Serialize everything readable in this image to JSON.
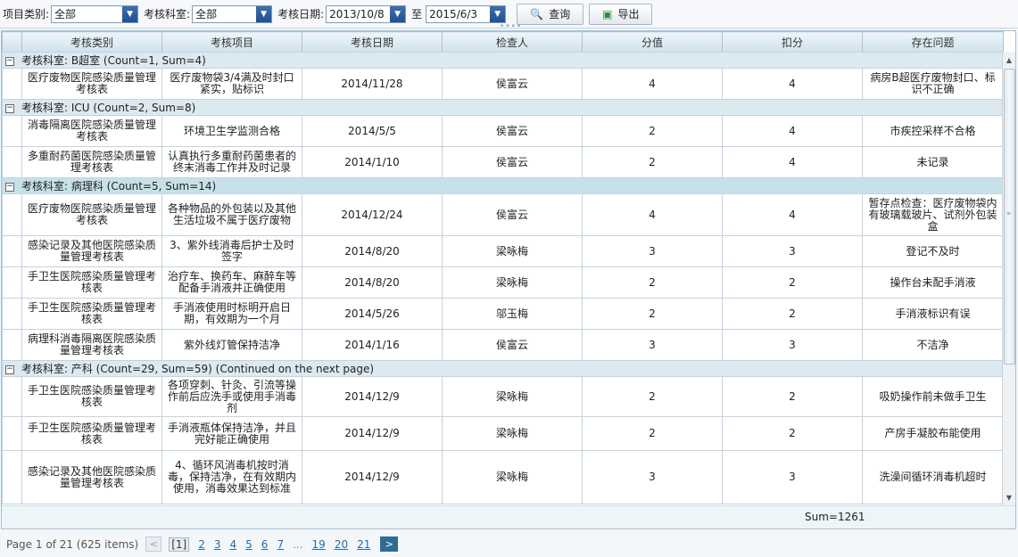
{
  "toolbar": {
    "category_label": "项目类别:",
    "category_value": "全部",
    "dept_label": "考核科室:",
    "dept_value": "全部",
    "date_label": "考核日期:",
    "date_from": "2013/10/8",
    "date_to_label": "至",
    "date_to": "2015/6/3",
    "query_label": "查询",
    "export_label": "导出"
  },
  "columns": [
    "考核类别",
    "考核项目",
    "考核日期",
    "检查人",
    "分值",
    "扣分",
    "存在问题"
  ],
  "groups": [
    {
      "header": "考核科室: B超室 (Count=1, Sum=4)",
      "rows": [
        {
          "category": "医疗废物医院感染质量管理考核表",
          "item": "医疗废物袋3/4满及时封口紧实，贴标识",
          "date": "2014/11/28",
          "inspector": "侯富云",
          "score": "4",
          "deduct": "4",
          "problem": "病房B超医疗废物封口、标识不正确"
        }
      ]
    },
    {
      "header": "考核科室: ICU (Count=2, Sum=8)",
      "rows": [
        {
          "category": "消毒隔离医院感染质量管理考核表",
          "item": "环境卫生学监测合格",
          "date": "2014/5/5",
          "inspector": "侯富云",
          "score": "2",
          "deduct": "4",
          "problem": "市疾控采样不合格"
        },
        {
          "category": "多重耐药菌医院感染质量管理考核表",
          "item": "认真执行多重耐药菌患者的终末消毒工作并及时记录",
          "date": "2014/1/10",
          "inspector": "侯富云",
          "score": "2",
          "deduct": "4",
          "problem": "未记录"
        }
      ]
    },
    {
      "header": "考核科室: 病理科 (Count=5, Sum=14)",
      "rows": [
        {
          "category": "医疗废物医院感染质量管理考核表",
          "item": "各种物品的外包装以及其他生活垃圾不属于医疗废物",
          "date": "2014/12/24",
          "inspector": "侯富云",
          "score": "4",
          "deduct": "4",
          "problem": "暂存点检查：医疗废物袋内有玻璃载玻片、试剂外包装盒"
        },
        {
          "category": "感染记录及其他医院感染质量管理考核表",
          "item": "3、紫外线消毒后护士及时签字",
          "date": "2014/8/20",
          "inspector": "梁咏梅",
          "score": "3",
          "deduct": "3",
          "problem": "登记不及时"
        },
        {
          "category": "手卫生医院感染质量管理考核表",
          "item": "治疗车、换药车、麻醉车等配备手消液并正确使用",
          "date": "2014/8/20",
          "inspector": "梁咏梅",
          "score": "2",
          "deduct": "2",
          "problem": "操作台未配手消液"
        },
        {
          "category": "手卫生医院感染质量管理考核表",
          "item": "手消液使用时标明开启日期，有效期为一个月",
          "date": "2014/5/26",
          "inspector": "邬玉梅",
          "score": "2",
          "deduct": "2",
          "problem": "手消液标识有误"
        },
        {
          "category": "病理科消毒隔离医院感染质量管理考核表",
          "item": "紫外线灯管保持洁净",
          "date": "2014/1/16",
          "inspector": "侯富云",
          "score": "3",
          "deduct": "3",
          "problem": "不洁净"
        }
      ]
    },
    {
      "header": "考核科室: 产科 (Count=29, Sum=59) (Continued on the next page)",
      "rows": [
        {
          "category": "手卫生医院感染质量管理考核表",
          "item": "各项穿刺、针灸、引流等操作前后应洗手或使用手消毒剂",
          "date": "2014/12/9",
          "inspector": "梁咏梅",
          "score": "2",
          "deduct": "2",
          "problem": "吸奶操作前未做手卫生"
        },
        {
          "category": "手卫生医院感染质量管理考核表",
          "item": "手消液瓶体保持洁净，并且完好能正确使用",
          "date": "2014/12/9",
          "inspector": "梁咏梅",
          "score": "2",
          "deduct": "2",
          "problem": "产房手凝胶布能使用"
        },
        {
          "category": "感染记录及其他医院感染质量管理考核表",
          "item": "4、循环风消毒机按时消毒，保持洁净，在有效期内使用，消毒效果达到标准",
          "date": "2014/12/9",
          "inspector": "梁咏梅",
          "score": "3",
          "deduct": "3",
          "problem": "洗澡间循环消毒机超时"
        }
      ]
    }
  ],
  "summary": {
    "sum_text": "Sum=1261"
  },
  "pager": {
    "info": "Page 1 of 21 (625 items)",
    "prev": "<",
    "current": "[1]",
    "pages": [
      "2",
      "3",
      "4",
      "5",
      "6",
      "7"
    ],
    "ellipsis": "...",
    "tail_pages": [
      "19",
      "20",
      "21"
    ],
    "next": ">"
  },
  "icons": {
    "query": "search-icon",
    "export": "export-icon",
    "dropdown": "chevron-down-icon"
  }
}
